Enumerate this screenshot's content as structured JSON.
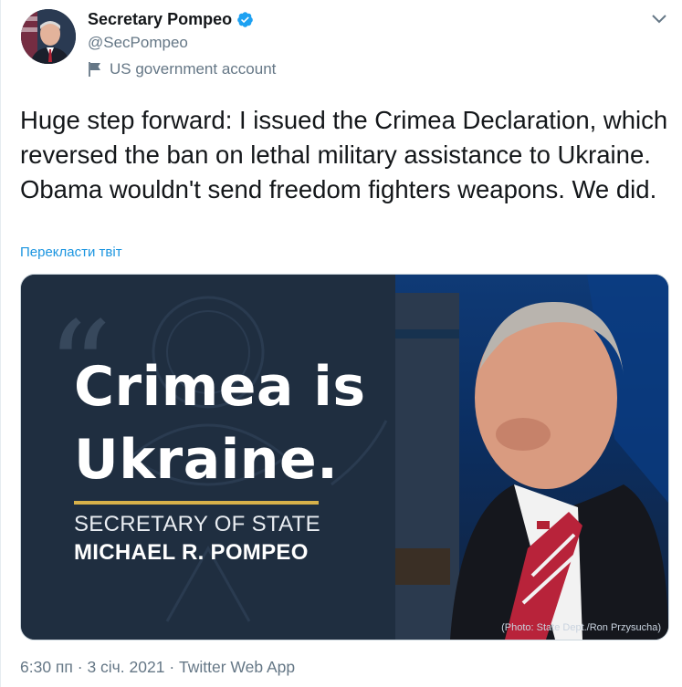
{
  "author": {
    "display_name": "Secretary Pompeo",
    "handle": "@SecPompeo",
    "label": "US government account"
  },
  "tweet": {
    "text": "Huge step forward: I issued the Crimea Declaration, which reversed the ban on lethal military assistance to Ukraine. Obama wouldn't send freedom fighters weapons. We did.",
    "translate_link": "Перекласти твіт"
  },
  "media": {
    "headline_line1": "Crimea is",
    "headline_line2": "Ukraine.",
    "title": "SECRETARY OF STATE",
    "name": "MICHAEL R. POMPEO",
    "credit": "(Photo: State Dept./Ron Przysucha)"
  },
  "meta": {
    "time": "6:30 пп",
    "separator": " · ",
    "date": "3 січ. 2021",
    "source": "Twitter Web App"
  },
  "colors": {
    "verified": "#1da1f2",
    "link": "#1b95e0",
    "gold": "#d7b14a"
  },
  "icons": [
    "verified-badge-icon",
    "government-flag-icon",
    "chevron-down-icon"
  ]
}
